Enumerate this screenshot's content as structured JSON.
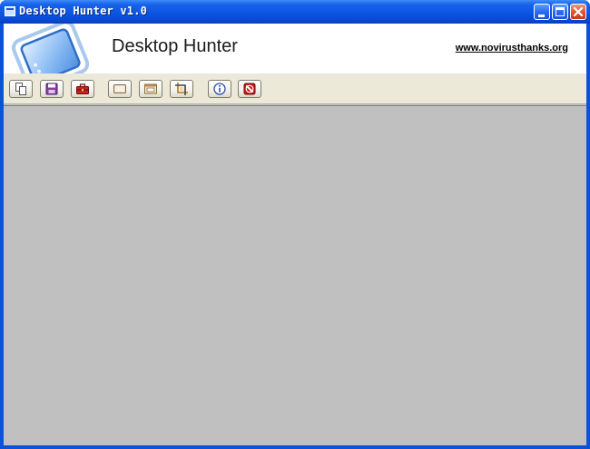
{
  "window": {
    "title": "Desktop Hunter v1.0",
    "controls": {
      "minimize_icon": "minimize-icon",
      "maximize_icon": "maximize-icon",
      "close_icon": "close-icon"
    }
  },
  "header": {
    "app_name": "Desktop Hunter",
    "website": "www.novirusthanks.org",
    "logo_icon": "monitor-logo-icon"
  },
  "toolbar": {
    "buttons": [
      {
        "id": "copy",
        "icon": "copy-icon"
      },
      {
        "id": "save",
        "icon": "save-icon"
      },
      {
        "id": "toolbox",
        "icon": "toolbox-icon"
      },
      {
        "id": "capture-screen",
        "icon": "capture-screen-icon"
      },
      {
        "id": "capture-window",
        "icon": "capture-window-icon"
      },
      {
        "id": "capture-region",
        "icon": "crop-icon"
      },
      {
        "id": "about",
        "icon": "info-icon"
      },
      {
        "id": "exit",
        "icon": "exit-icon"
      }
    ]
  },
  "colors": {
    "titlebar": "#0a55e2",
    "toolbar_bg": "#ece9d8",
    "canvas_bg": "#c0c0c0",
    "close_button": "#e0553a"
  }
}
